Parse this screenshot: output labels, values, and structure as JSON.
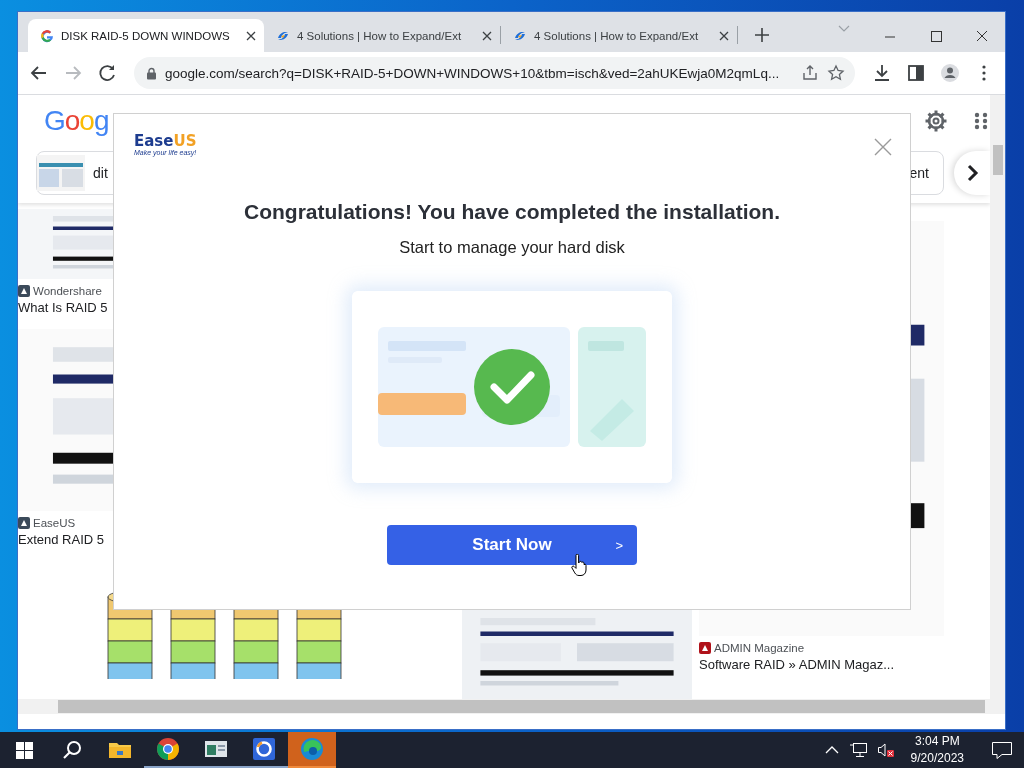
{
  "browser": {
    "tabs": [
      {
        "title": "DISK RAID-5 DOWN WINDOWS",
        "kind": "google",
        "selected": true
      },
      {
        "title": "4 Solutions | How to Expand/Ext",
        "kind": "easeus",
        "selected": false
      },
      {
        "title": "4 Solutions | How to Expand/Ext",
        "kind": "easeus",
        "selected": false
      }
    ],
    "address": "google.com/search?q=DISK+RAID-5+DOWN+WINDOWS+10&tbm=isch&ved=2ahUKEwja0M2qmLq...",
    "forward_disabled": true
  },
  "page": {
    "logo": "Goog",
    "chips": [
      {
        "label": "dit"
      },
      {
        "label": "ent"
      }
    ],
    "column_1": [
      {
        "source": "Wondershare",
        "title": "What Is RAID 5"
      },
      {
        "source": "EaseUS",
        "title": "Extend RAID 5"
      }
    ],
    "column_3": [
      {
        "source": "ADMIN Magazine",
        "title": "Software RAID » ADMIN Magaz..."
      }
    ]
  },
  "dialog": {
    "brand": [
      "Ease",
      "US"
    ],
    "tagline": "Make your life easy!",
    "heading": "Congratulations! You have completed the installation.",
    "subheading": "Start to manage your hard disk",
    "button": "Start Now",
    "button_arrow": ">"
  },
  "taskbar": {
    "apps": [
      {
        "kind": "explorer",
        "running": false,
        "selected": false
      },
      {
        "kind": "chrome",
        "running": true,
        "selected": false
      },
      {
        "kind": "manager",
        "running": true,
        "selected": false
      },
      {
        "kind": "easeus",
        "running": true,
        "selected": false
      },
      {
        "kind": "edge",
        "running": true,
        "selected": true
      }
    ],
    "time": "3:04 PM",
    "date": "9/20/2023"
  }
}
